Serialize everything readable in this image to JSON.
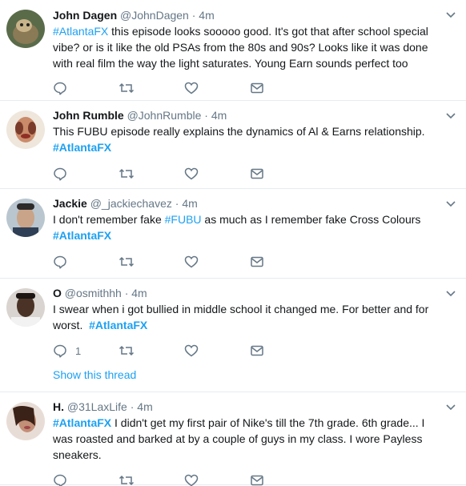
{
  "colors": {
    "link": "#1da1f2",
    "muted": "#657786",
    "text": "#14171a",
    "divider": "#e6ecf0"
  },
  "tweets": [
    {
      "name": "John Dagen",
      "handle": "@JohnDagen",
      "dot": "·",
      "time": "4m",
      "text_parts": [
        {
          "t": "#AtlantaFX",
          "tag": true
        },
        {
          "t": " this episode looks sooooo good. It's got that after school special vibe? or is it like the old PSAs from the 80s and 90s? Looks like it was done with real film the way the light saturates. Young Earn sounds perfect too"
        }
      ],
      "reply_count": ""
    },
    {
      "name": "John Rumble",
      "handle": "@JohnRumble",
      "dot": "·",
      "time": "4m",
      "text_parts": [
        {
          "t": "This FUBU episode really explains the dynamics of Al & Earns relationship. "
        },
        {
          "t": "#AtlantaFX",
          "tag": true,
          "bold": true
        }
      ],
      "reply_count": ""
    },
    {
      "name": "Jackie",
      "handle": "@_jackiechavez",
      "dot": "·",
      "time": "4m",
      "text_parts": [
        {
          "t": "I don't remember fake "
        },
        {
          "t": "#FUBU",
          "tag": true
        },
        {
          "t": " as much as I remember fake Cross Colours "
        },
        {
          "t": "#AtlantaFX",
          "tag": true,
          "bold": true
        }
      ],
      "reply_count": ""
    },
    {
      "name": "O",
      "handle": "@osmithhh",
      "dot": "·",
      "time": "4m",
      "text_parts": [
        {
          "t": "I swear when i got bullied in middle school it changed me. For better and for worst.  "
        },
        {
          "t": "#AtlantaFX",
          "tag": true,
          "bold": true
        }
      ],
      "reply_count": "1",
      "show_thread": "Show this thread"
    },
    {
      "name": "H.",
      "handle": "@31LaxLife",
      "dot": "·",
      "time": "4m",
      "text_parts": [
        {
          "t": "#AtlantaFX",
          "tag": true,
          "bold": true
        },
        {
          "t": " I didn't get my first pair of Nike's till the 7th grade. 6th grade... I was roasted and barked at by a couple of guys in my class. I wore Payless sneakers."
        }
      ],
      "reply_count": ""
    }
  ]
}
